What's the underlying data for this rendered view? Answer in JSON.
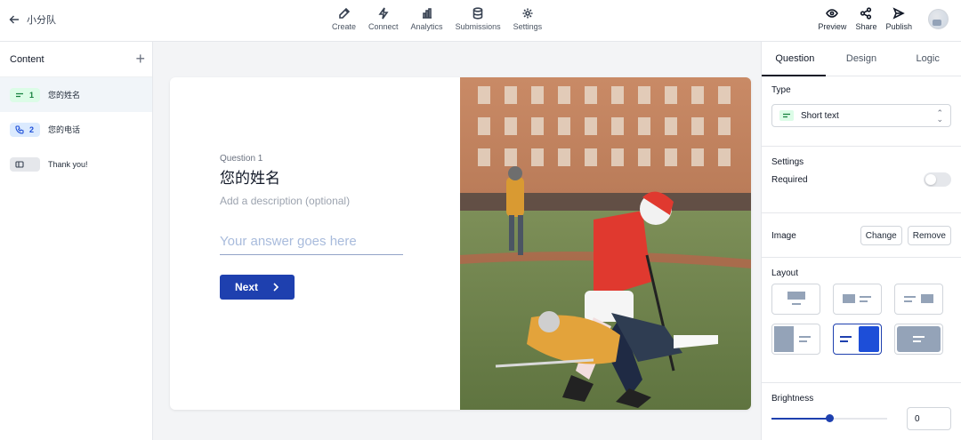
{
  "header": {
    "back_label": "小分队",
    "nav": [
      {
        "label": "Create",
        "icon": "edit-icon"
      },
      {
        "label": "Connect",
        "icon": "bolt-icon"
      },
      {
        "label": "Analytics",
        "icon": "bar-chart-icon"
      },
      {
        "label": "Submissions",
        "icon": "database-icon"
      },
      {
        "label": "Settings",
        "icon": "gear-icon"
      }
    ],
    "actions": [
      {
        "label": "Preview",
        "icon": "eye-icon"
      },
      {
        "label": "Share",
        "icon": "share-icon"
      },
      {
        "label": "Publish",
        "icon": "send-icon"
      }
    ]
  },
  "sidebar": {
    "title": "Content",
    "add_icon": "+",
    "items": [
      {
        "number": "1",
        "label": "您的姓名",
        "icon": "short-text-icon"
      },
      {
        "number": "2",
        "label": "您的电话",
        "icon": "phone-icon"
      },
      {
        "number": "",
        "label": "Thank you!",
        "icon": "end-screen-icon"
      }
    ]
  },
  "question": {
    "number_label": "Question 1",
    "title": "您的姓名",
    "description_placeholder": "Add a description (optional)",
    "answer_placeholder": "Your answer goes here",
    "next_label": "Next"
  },
  "panel": {
    "tabs": [
      "Question",
      "Design",
      "Logic"
    ],
    "type_label": "Type",
    "type_value": "Short text",
    "settings_label": "Settings",
    "required_label": "Required",
    "required_on": false,
    "image_label": "Image",
    "change_label": "Change",
    "remove_label": "Remove",
    "layout_label": "Layout",
    "selected_layout": 5,
    "brightness_label": "Brightness",
    "brightness_value": "0"
  },
  "colors": {
    "accent": "#1e40af",
    "short_text_chip": "#dcfce7",
    "phone_chip": "#dbeafe"
  }
}
